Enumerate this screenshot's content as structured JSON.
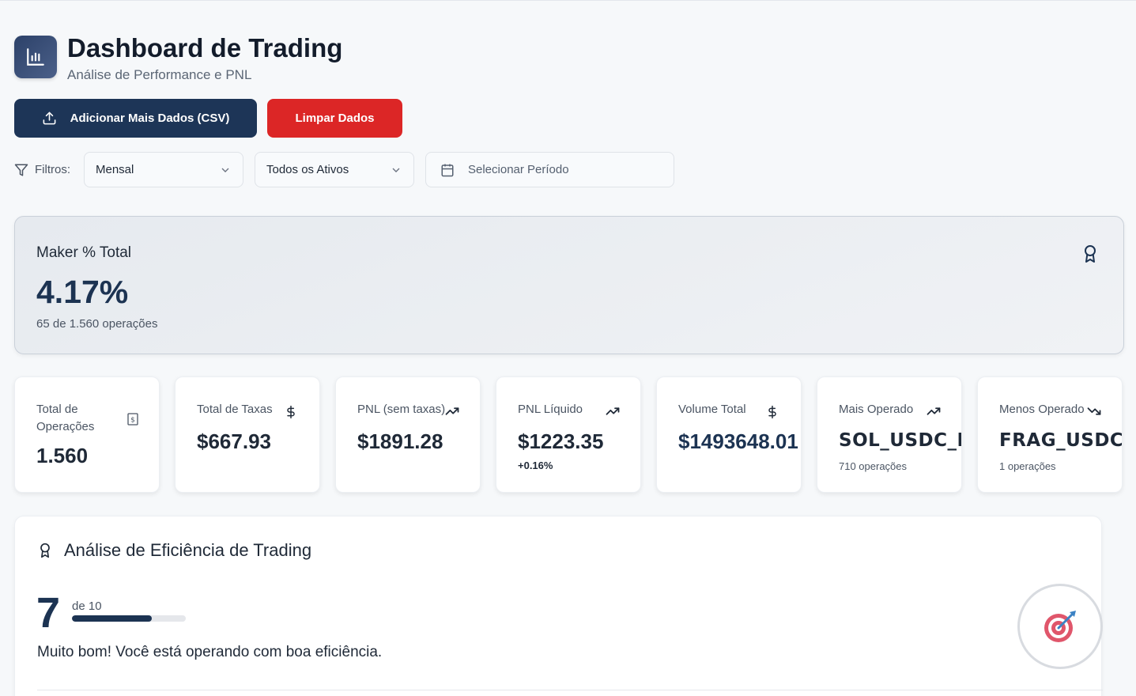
{
  "header": {
    "title": "Dashboard de Trading",
    "subtitle": "Análise de Performance e PNL",
    "logo_icon": "bar-chart-icon"
  },
  "actions": {
    "add_data_label": "Adicionar Mais Dados (CSV)",
    "clear_data_label": "Limpar Dados"
  },
  "filters": {
    "label": "Filtros:",
    "period_type": "Mensal",
    "assets": "Todos os Ativos",
    "date_range_placeholder": "Selecionar Período"
  },
  "maker": {
    "label": "Maker % Total",
    "value": "4.17%",
    "sub": "65 de 1.560 operações"
  },
  "cards": [
    {
      "label": "Total de Operações",
      "value": "1.560",
      "icon": "receipt-icon"
    },
    {
      "label": "Total de Taxas",
      "value": "$667.93",
      "icon": "dollar-icon"
    },
    {
      "label": "PNL (sem taxas)",
      "value": "$1891.28",
      "icon": "trending-up-icon"
    },
    {
      "label": "PNL Líquido",
      "value": "$1223.35",
      "change": "+0.16%",
      "icon": "trending-up-icon"
    },
    {
      "label": "Volume Total",
      "value": "$1493648.01",
      "icon": "dollar-icon"
    },
    {
      "label": "Mais Operado",
      "value": "SOL_USDC_PERP",
      "sub": "710 operações",
      "icon": "trending-up-icon"
    },
    {
      "label": "Menos Operado",
      "value": "FRAG_USDC",
      "sub": "1 operações",
      "icon": "trending-down-icon"
    }
  ],
  "efficiency": {
    "title": "Análise de Eficiência de Trading",
    "score": "7",
    "score_of": "de 10",
    "score_fraction": 0.7,
    "message": "Muito bom! Você está operando com boa eficiência."
  },
  "colors": {
    "primary": "#1d3557",
    "danger": "#dc2626",
    "accent_value": "#1c3352"
  }
}
